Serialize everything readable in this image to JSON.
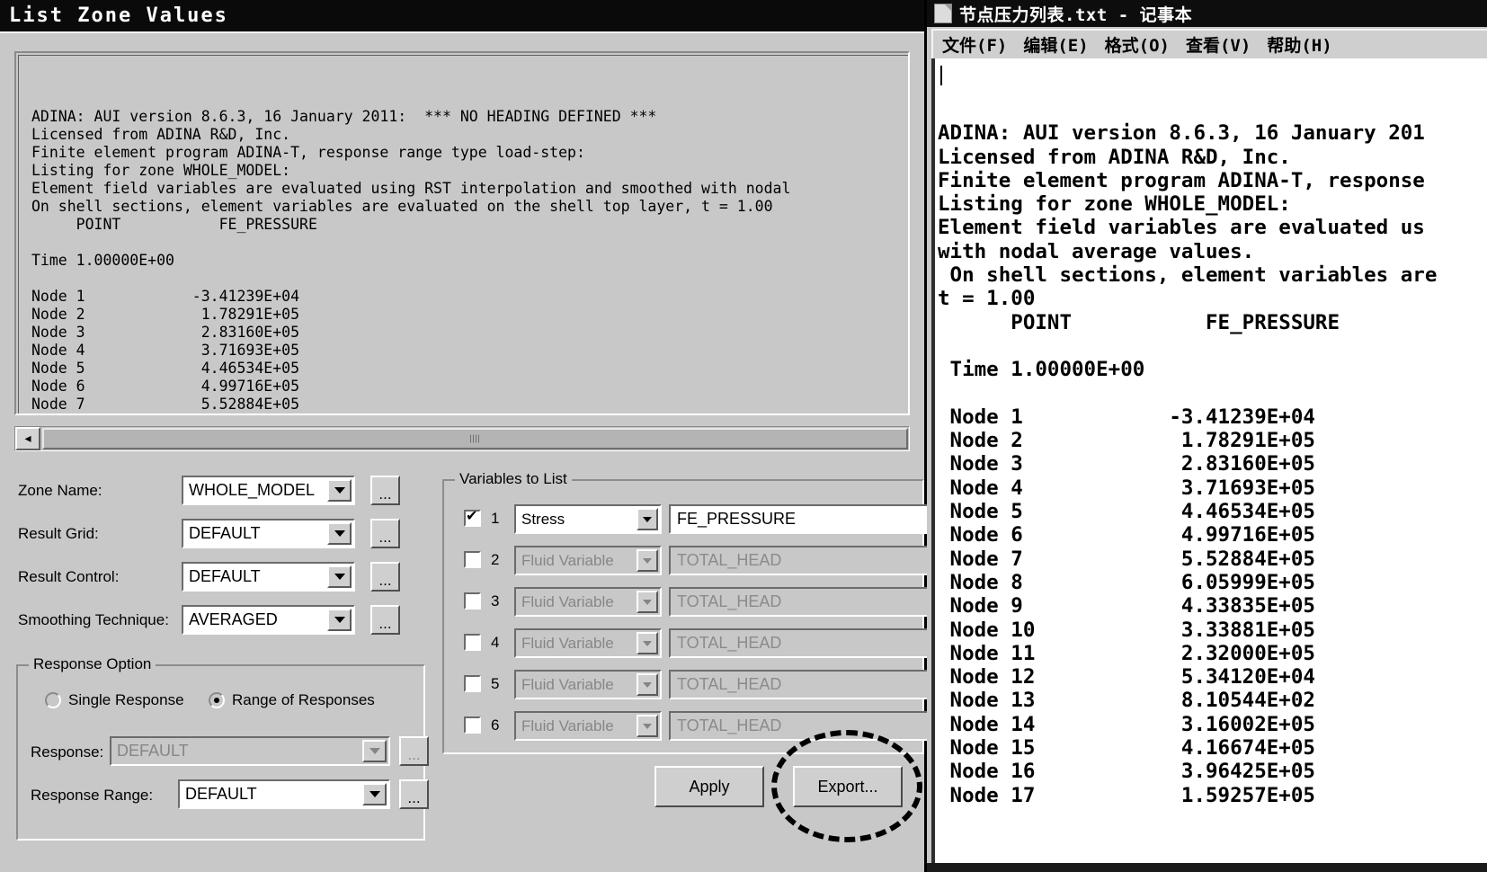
{
  "adina": {
    "title": "List Zone Values",
    "listing_text": "ADINA: AUI version 8.6.3, 16 January 2011:  *** NO HEADING DEFINED ***\nLicensed from ADINA R&D, Inc.\nFinite element program ADINA-T, response range type load-step:\nListing for zone WHOLE_MODEL:\nElement field variables are evaluated using RST interpolation and smoothed with nodal\nOn shell sections, element variables are evaluated on the shell top layer, t = 1.00\n     POINT           FE_PRESSURE\n\nTime 1.00000E+00\n\nNode 1            -3.41239E+04\nNode 2             1.78291E+05\nNode 3             2.83160E+05\nNode 4             3.71693E+05\nNode 5             4.46534E+05\nNode 6             4.99716E+05\nNode 7             5.52884E+05",
    "scrollbar": {
      "left_arrow_icon": "chevron-left-icon",
      "grip_icon": "scrollbar-grip-icon"
    },
    "fields": [
      {
        "label": "Zone Name:",
        "value": "WHOLE_MODEL",
        "browse": "...",
        "disabled": false
      },
      {
        "label": "Result Grid:",
        "value": "DEFAULT",
        "browse": "...",
        "disabled": false
      },
      {
        "label": "Result Control:",
        "value": "DEFAULT",
        "browse": "...",
        "disabled": false
      },
      {
        "label": "Smoothing Technique:",
        "value": "AVERAGED",
        "browse": "...",
        "disabled": false
      }
    ],
    "response_option": {
      "title": "Response Option",
      "radios": [
        {
          "label": "Single Response",
          "selected": false
        },
        {
          "label": "Range of Responses",
          "selected": true
        }
      ],
      "response": {
        "label": "Response:",
        "value": "DEFAULT",
        "browse": "...",
        "disabled": true
      },
      "response_range": {
        "label": "Response Range:",
        "value": "DEFAULT",
        "browse": "...",
        "disabled": false
      }
    },
    "variables_group": {
      "title": "Variables to List",
      "rows": [
        {
          "num": "1",
          "checked": true,
          "type": "Stress",
          "name": "FE_PRESSURE"
        },
        {
          "num": "2",
          "checked": false,
          "type": "Fluid Variable",
          "name": "TOTAL_HEAD"
        },
        {
          "num": "3",
          "checked": false,
          "type": "Fluid Variable",
          "name": "TOTAL_HEAD"
        },
        {
          "num": "4",
          "checked": false,
          "type": "Fluid Variable",
          "name": "TOTAL_HEAD"
        },
        {
          "num": "5",
          "checked": false,
          "type": "Fluid Variable",
          "name": "TOTAL_HEAD"
        },
        {
          "num": "6",
          "checked": false,
          "type": "Fluid Variable",
          "name": "TOTAL_HEAD"
        }
      ]
    },
    "buttons": {
      "apply": "Apply",
      "export": "Export..."
    },
    "annotation": {
      "shape": "dashed-ellipse-highlight",
      "target": "Export..."
    }
  },
  "notepad": {
    "icon": "notepad-document-icon",
    "title": "节点压力列表.txt - 记事本",
    "menu": [
      "文件(F)",
      "编辑(E)",
      "格式(O)",
      "查看(V)",
      "帮助(H)"
    ],
    "content": "\nADINA: AUI version 8.6.3, 16 January 201\nLicensed from ADINA R&D, Inc.\nFinite element program ADINA-T, response\nListing for zone WHOLE_MODEL:\nElement field variables are evaluated us\nwith nodal average values.\n On shell sections, element variables are\nt = 1.00\n      POINT           FE_PRESSURE\n\n Time 1.00000E+00\n\n Node 1            -3.41239E+04\n Node 2             1.78291E+05\n Node 3             2.83160E+05\n Node 4             3.71693E+05\n Node 5             4.46534E+05\n Node 6             4.99716E+05\n Node 7             5.52884E+05\n Node 8             6.05999E+05\n Node 9             4.33835E+05\n Node 10            3.33881E+05\n Node 11            2.32000E+05\n Node 12            5.34120E+04\n Node 13            8.10544E+02\n Node 14            3.16002E+05\n Node 15            4.16674E+05\n Node 16            3.96425E+05\n Node 17            1.59257E+05"
  },
  "node_table": {
    "columns": [
      "POINT",
      "FE_PRESSURE"
    ],
    "time": "1.00000E+00",
    "rows": [
      {
        "point": "Node 1",
        "fe_pressure": "-3.41239E+04"
      },
      {
        "point": "Node 2",
        "fe_pressure": "1.78291E+05"
      },
      {
        "point": "Node 3",
        "fe_pressure": "2.83160E+05"
      },
      {
        "point": "Node 4",
        "fe_pressure": "3.71693E+05"
      },
      {
        "point": "Node 5",
        "fe_pressure": "4.46534E+05"
      },
      {
        "point": "Node 6",
        "fe_pressure": "4.99716E+05"
      },
      {
        "point": "Node 7",
        "fe_pressure": "5.52884E+05"
      },
      {
        "point": "Node 8",
        "fe_pressure": "6.05999E+05"
      },
      {
        "point": "Node 9",
        "fe_pressure": "4.33835E+05"
      },
      {
        "point": "Node 10",
        "fe_pressure": "3.33881E+05"
      },
      {
        "point": "Node 11",
        "fe_pressure": "2.32000E+05"
      },
      {
        "point": "Node 12",
        "fe_pressure": "5.34120E+04"
      },
      {
        "point": "Node 13",
        "fe_pressure": "8.10544E+02"
      },
      {
        "point": "Node 14",
        "fe_pressure": "3.16002E+05"
      },
      {
        "point": "Node 15",
        "fe_pressure": "4.16674E+05"
      },
      {
        "point": "Node 16",
        "fe_pressure": "3.96425E+05"
      },
      {
        "point": "Node 17",
        "fe_pressure": "1.59257E+05"
      }
    ]
  }
}
